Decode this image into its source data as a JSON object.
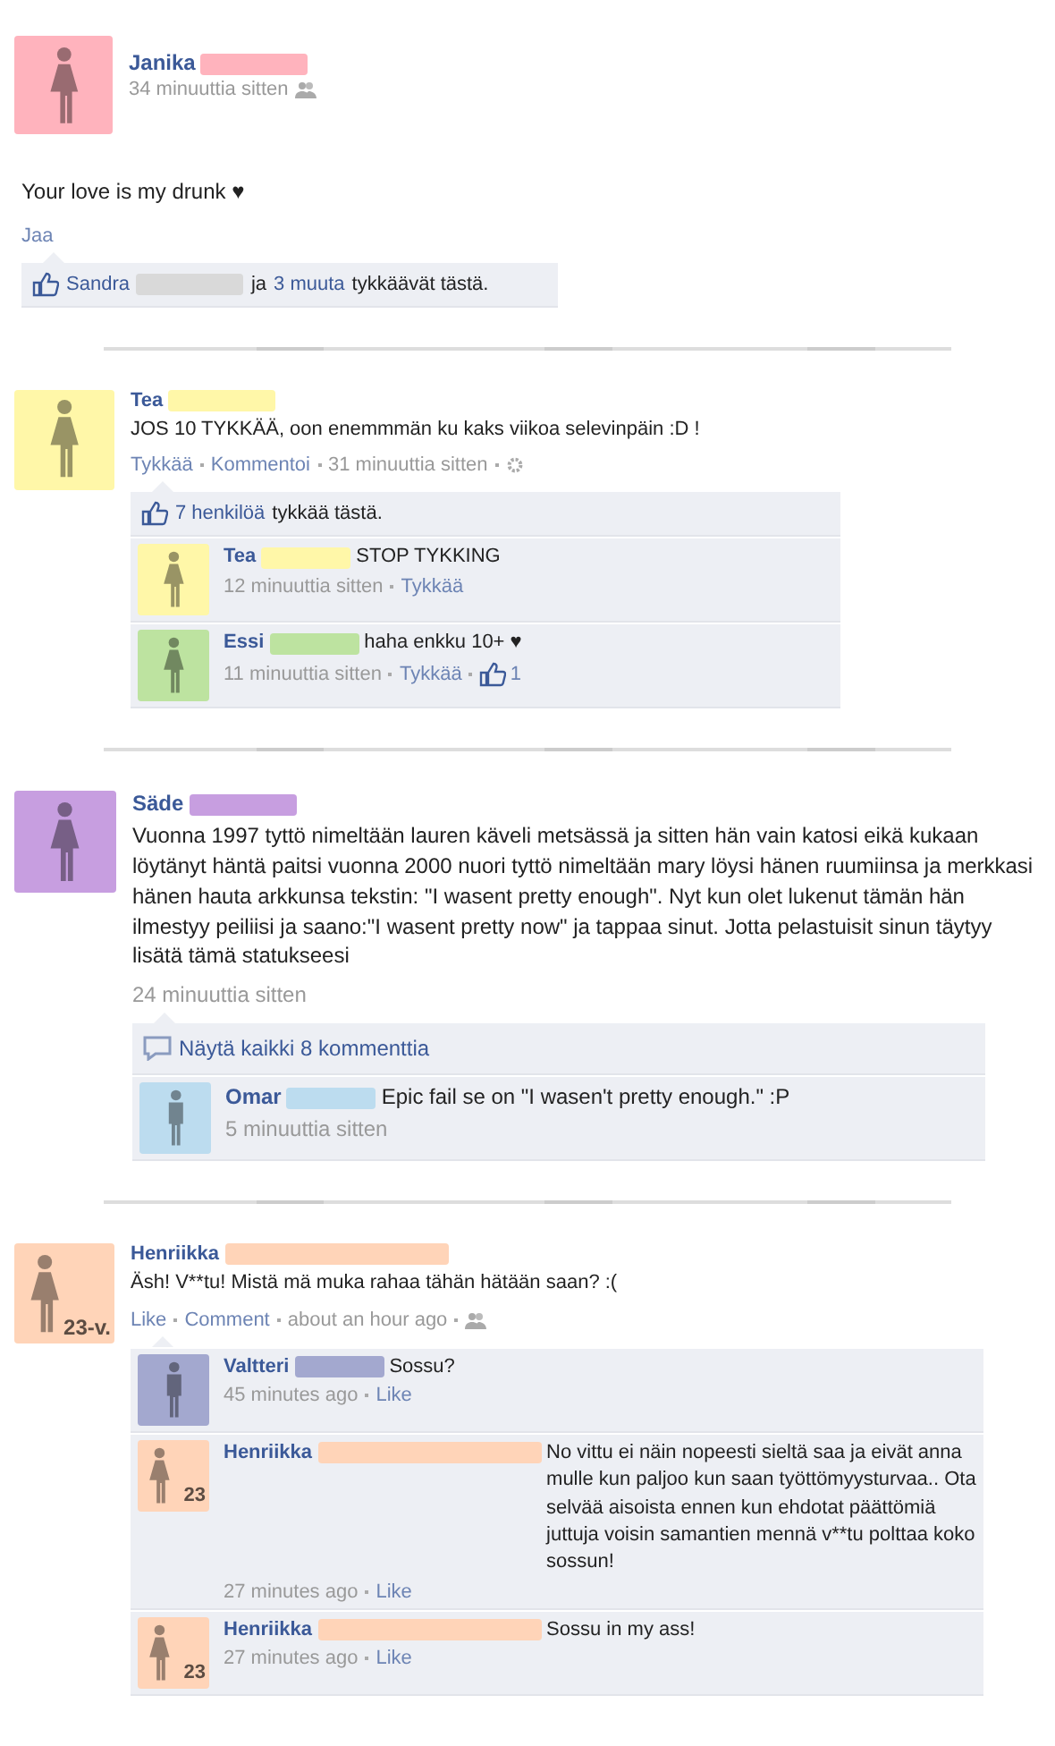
{
  "posts": [
    {
      "kind": "classic",
      "author": {
        "name": "Janika",
        "color": "#ffb3bd",
        "kind": "female"
      },
      "meta": [
        {
          "kind": "time",
          "text": "34 minuuttia sitten"
        },
        {
          "kind": "audience"
        }
      ],
      "body": "Your love is my drunk ♥",
      "actions": [
        {
          "kind": "link",
          "text": "Jaa"
        }
      ],
      "likes": [
        {
          "kind": "like-icon"
        },
        {
          "kind": "link",
          "text": "Sandra"
        },
        {
          "kind": "redaction",
          "color": "#d9d9d9"
        },
        {
          "kind": "text",
          "text": "ja"
        },
        {
          "kind": "link",
          "text": "3 muuta"
        },
        {
          "kind": "text",
          "text": "tykkäävät tästä."
        }
      ]
    },
    {
      "kind": "compact",
      "author": {
        "name": "Tea",
        "color": "#fff7a8",
        "kind": "female"
      },
      "body": "JOS 10 TYKKÄÄ, oon enemmmän ku kaks viikoa selevinpäin :D !",
      "meta": [
        {
          "kind": "link",
          "text": "Tykkää"
        },
        {
          "kind": "link",
          "text": "Kommentoi"
        },
        {
          "kind": "time",
          "text": "31 minuuttia sitten"
        },
        {
          "kind": "gear"
        }
      ],
      "likes": [
        {
          "kind": "like-icon"
        },
        {
          "kind": "link",
          "text": "7 henkilöä"
        },
        {
          "kind": "text",
          "text": "tykkää tästä."
        }
      ],
      "comments": [
        {
          "author": {
            "name": "Tea",
            "color": "#fff7a8",
            "kind": "female"
          },
          "text": "STOP TYKKING",
          "meta": [
            {
              "kind": "time",
              "text": "12 minuuttia sitten"
            },
            {
              "kind": "link",
              "text": "Tykkää"
            }
          ]
        },
        {
          "author": {
            "name": "Essi",
            "color": "#bde3a0",
            "kind": "female"
          },
          "text": "haha enkku 10+ ♥",
          "meta": [
            {
              "kind": "time",
              "text": "11 minuuttia sitten"
            },
            {
              "kind": "link",
              "text": "Tykkää"
            },
            {
              "kind": "like-count",
              "text": "1"
            }
          ]
        }
      ]
    },
    {
      "kind": "large",
      "author": {
        "name": "Säde",
        "color": "#c79ee0",
        "kind": "female"
      },
      "body": "Vuonna 1997 tyttö nimeltään lauren käveli metsässä ja sitten hän vain katosi eikä kukaan löytänyt häntä paitsi vuonna 2000 nuori tyttö nimeltään mary löysi hänen ruumiinsa ja merkkasi hänen hauta arkkunsa tekstin: \"I wasent pretty enough\". Nyt kun olet lukenut tämän hän ilmestyy peiliisi ja saano:\"I wasent pretty now\" ja tappaa sinut. Jotta pelastuisit sinun täytyy lisätä tämä statukseesi",
      "meta": [
        {
          "kind": "time",
          "text": "24 minuuttia sitten"
        }
      ],
      "show_all": "Näytä kaikki 8 kommenttia",
      "comments": [
        {
          "author": {
            "name": "Omar",
            "color": "#bcdcef",
            "kind": "male"
          },
          "text": "Epic fail se on \"I wasen't pretty enough.\" :P",
          "meta": [
            {
              "kind": "time",
              "text": "5 minuuttia sitten"
            }
          ]
        }
      ]
    },
    {
      "kind": "modern",
      "author": {
        "name": "Henriikka",
        "color": "#ffd4b8",
        "kind": "female",
        "badge": "23-v."
      },
      "body": "Äsh! V**tu! Mistä mä muka rahaa tähän hätään saan? :(",
      "meta": [
        {
          "kind": "link",
          "text": "Like"
        },
        {
          "kind": "link",
          "text": "Comment"
        },
        {
          "kind": "time",
          "text": "about an hour ago"
        },
        {
          "kind": "audience"
        }
      ],
      "comments": [
        {
          "author": {
            "name": "Valtteri",
            "color": "#a3a8cf",
            "kind": "male"
          },
          "text": "Sossu?",
          "meta": [
            {
              "kind": "time",
              "text": "45 minutes ago"
            },
            {
              "kind": "link",
              "text": "Like"
            }
          ]
        },
        {
          "author": {
            "name": "Henriikka",
            "color": "#ffd4b8",
            "kind": "female",
            "badge": "23"
          },
          "text": "No vittu ei näin nopeesti sieltä saa ja eivät anna mulle kun paljoo kun saan työttömyysturvaa.. Ota selvää aisoista ennen kun ehdotat päättömiä juttuja voisin samantien mennä v**tu polttaa koko sossun!",
          "meta": [
            {
              "kind": "time",
              "text": "27 minutes ago"
            },
            {
              "kind": "link",
              "text": "Like"
            }
          ]
        },
        {
          "author": {
            "name": "Henriikka",
            "color": "#ffd4b8",
            "kind": "female",
            "badge": "23"
          },
          "text": "Sossu in my ass!",
          "meta": [
            {
              "kind": "time",
              "text": "27 minutes ago"
            },
            {
              "kind": "link",
              "text": "Like"
            }
          ]
        }
      ]
    }
  ]
}
